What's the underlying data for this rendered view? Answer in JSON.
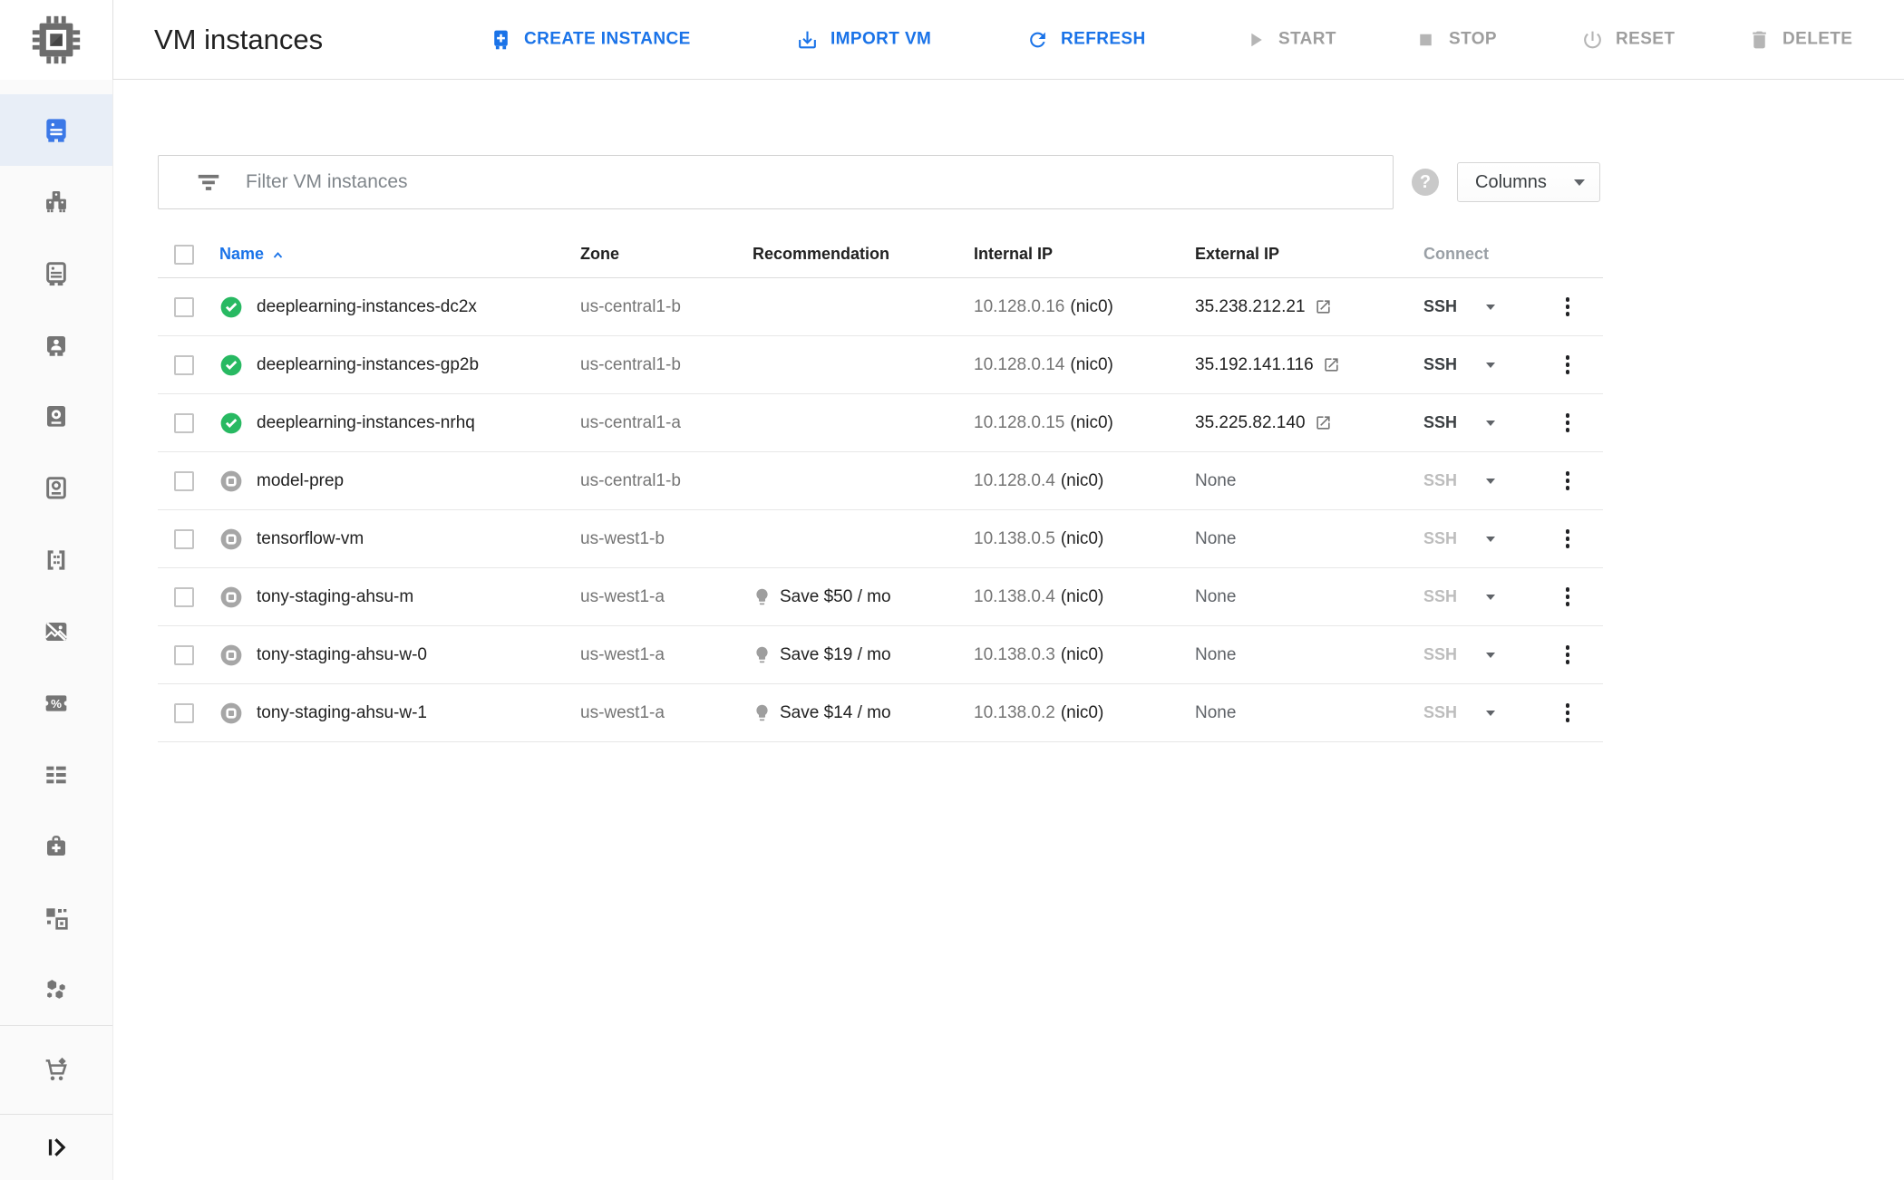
{
  "app": {
    "title": "VM instances",
    "product_icon": "compute-engine-logo-icon"
  },
  "toolbar": {
    "create_instance": "CREATE INSTANCE",
    "import_vm": "IMPORT VM",
    "refresh": "REFRESH",
    "start": "START",
    "stop": "STOP",
    "reset": "RESET",
    "delete": "DELETE"
  },
  "filter": {
    "placeholder": "Filter VM instances",
    "columns_label": "Columns",
    "help_icon": "help-icon",
    "filter_icon": "filter-icon"
  },
  "sidebar": {
    "items": [
      {
        "icon": "vm-instances-icon",
        "active": true
      },
      {
        "icon": "instance-groups-icon",
        "active": false
      },
      {
        "icon": "instance-templates-icon",
        "active": false
      },
      {
        "icon": "sole-tenant-nodes-icon",
        "active": false
      },
      {
        "icon": "disks-icon",
        "active": false
      },
      {
        "icon": "snapshots-icon",
        "active": false
      },
      {
        "icon": "images-icon",
        "active": false
      },
      {
        "icon": "tpus-icon",
        "active": false
      },
      {
        "icon": "committed-use-discounts-icon",
        "active": false
      },
      {
        "icon": "metadata-icon",
        "active": false
      },
      {
        "icon": "health-checks-icon",
        "active": false
      },
      {
        "icon": "zones-icon",
        "active": false
      },
      {
        "icon": "network-endpoint-groups-icon",
        "active": false
      }
    ],
    "marketplace": {
      "icon": "marketplace-icon"
    },
    "collapse": {
      "icon": "collapse-panel-icon"
    }
  },
  "table": {
    "columns": {
      "name": "Name",
      "zone": "Zone",
      "recommendation": "Recommendation",
      "internal_ip": "Internal IP",
      "external_ip": "External IP",
      "connect": "Connect"
    },
    "sort": {
      "column": "Name",
      "direction": "ascending"
    },
    "rows": [
      {
        "name": "deeplearning-instances-dc2x",
        "status": "running",
        "zone": "us-central1-b",
        "recommendation": null,
        "internal_ip": "10.128.0.16",
        "nic": "(nic0)",
        "external_ip": "35.238.212.21",
        "external_link": true,
        "connect": "SSH",
        "connect_enabled": true
      },
      {
        "name": "deeplearning-instances-gp2b",
        "status": "running",
        "zone": "us-central1-b",
        "recommendation": null,
        "internal_ip": "10.128.0.14",
        "nic": "(nic0)",
        "external_ip": "35.192.141.116",
        "external_link": true,
        "connect": "SSH",
        "connect_enabled": true
      },
      {
        "name": "deeplearning-instances-nrhq",
        "status": "running",
        "zone": "us-central1-a",
        "recommendation": null,
        "internal_ip": "10.128.0.15",
        "nic": "(nic0)",
        "external_ip": "35.225.82.140",
        "external_link": true,
        "connect": "SSH",
        "connect_enabled": true
      },
      {
        "name": "model-prep",
        "status": "stopped",
        "zone": "us-central1-b",
        "recommendation": null,
        "internal_ip": "10.128.0.4",
        "nic": "(nic0)",
        "external_ip": "None",
        "external_link": false,
        "connect": "SSH",
        "connect_enabled": false
      },
      {
        "name": "tensorflow-vm",
        "status": "stopped",
        "zone": "us-west1-b",
        "recommendation": null,
        "internal_ip": "10.138.0.5",
        "nic": "(nic0)",
        "external_ip": "None",
        "external_link": false,
        "connect": "SSH",
        "connect_enabled": false
      },
      {
        "name": "tony-staging-ahsu-m",
        "status": "stopped",
        "zone": "us-west1-a",
        "recommendation": "Save $50 / mo",
        "internal_ip": "10.138.0.4",
        "nic": "(nic0)",
        "external_ip": "None",
        "external_link": false,
        "connect": "SSH",
        "connect_enabled": false
      },
      {
        "name": "tony-staging-ahsu-w-0",
        "status": "stopped",
        "zone": "us-west1-a",
        "recommendation": "Save $19 / mo",
        "internal_ip": "10.138.0.3",
        "nic": "(nic0)",
        "external_ip": "None",
        "external_link": false,
        "connect": "SSH",
        "connect_enabled": false
      },
      {
        "name": "tony-staging-ahsu-w-1",
        "status": "stopped",
        "zone": "us-west1-a",
        "recommendation": "Save $14 / mo",
        "internal_ip": "10.138.0.2",
        "nic": "(nic0)",
        "external_ip": "None",
        "external_link": false,
        "connect": "SSH",
        "connect_enabled": false
      }
    ]
  },
  "colors": {
    "accent_blue": "#1a73e8",
    "active_sidebar_icon": "#3b78e7",
    "active_sidebar_bg": "#e8eef7",
    "running_green": "#28b962",
    "stopped_grey": "#a6a6a6",
    "disabled_text": "#9e9e9e",
    "text_primary": "#212121",
    "text_secondary": "#757575"
  }
}
